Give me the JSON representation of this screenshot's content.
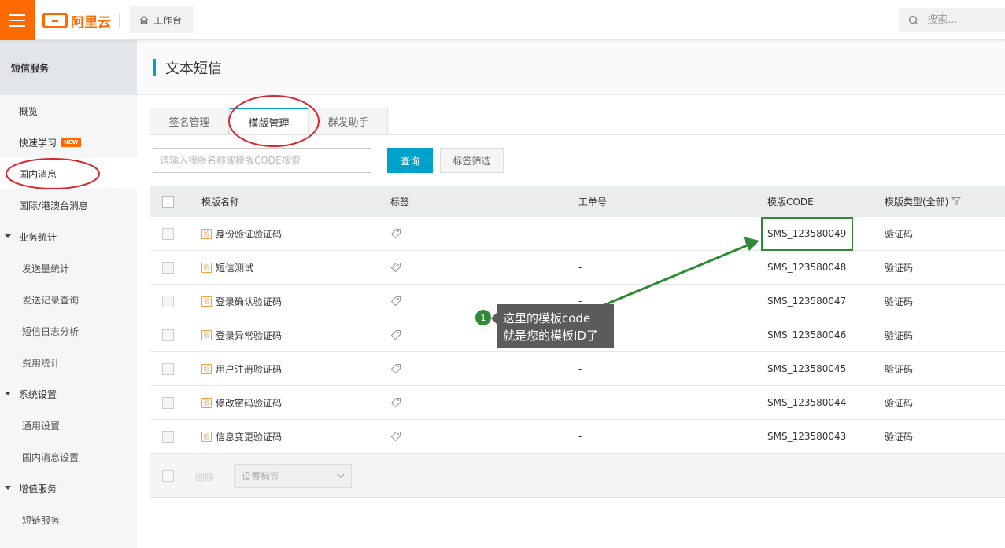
{
  "topbar": {
    "logo_text": "阿里云",
    "workbench_label": "工作台",
    "search_placeholder": "搜索..."
  },
  "sidebar": {
    "title": "短信服务",
    "items": [
      {
        "label": "概览"
      },
      {
        "label": "快速学习",
        "badge": "NEW"
      },
      {
        "label": "国内消息"
      },
      {
        "label": "国际/港澳台消息"
      },
      {
        "label": "业务统计"
      },
      {
        "label": "发送量统计"
      },
      {
        "label": "发送记录查询"
      },
      {
        "label": "短信日志分析"
      },
      {
        "label": "费用统计"
      },
      {
        "label": "系统设置"
      },
      {
        "label": "通用设置"
      },
      {
        "label": "国内消息设置"
      },
      {
        "label": "增值服务"
      },
      {
        "label": "短链服务"
      }
    ]
  },
  "page": {
    "title": "文本短信"
  },
  "tabs": [
    {
      "label": "签名管理"
    },
    {
      "label": "模版管理"
    },
    {
      "label": "群发助手"
    }
  ],
  "toolbar": {
    "search_placeholder": "请输入模版名称或模版CODE搜索",
    "query_label": "查询",
    "filter_label": "标签筛选"
  },
  "table": {
    "headers": {
      "name": "模版名称",
      "tag": "标签",
      "order": "工单号",
      "code": "模版CODE",
      "type": "模版类型(全部)"
    },
    "template_icon_text": "验",
    "rows": [
      {
        "name": "身份验证验证码",
        "order": "-",
        "code": "SMS_123580049",
        "type": "验证码"
      },
      {
        "name": "短信测试",
        "order": "-",
        "code": "SMS_123580048",
        "type": "验证码"
      },
      {
        "name": "登录确认验证码",
        "order": "-",
        "code": "SMS_123580047",
        "type": "验证码"
      },
      {
        "name": "登录异常验证码",
        "order": "-",
        "code": "SMS_123580046",
        "type": "验证码"
      },
      {
        "name": "用户注册验证码",
        "order": "-",
        "code": "SMS_123580045",
        "type": "验证码"
      },
      {
        "name": "修改密码验证码",
        "order": "-",
        "code": "SMS_123580044",
        "type": "验证码"
      },
      {
        "name": "信息变更验证码",
        "order": "-",
        "code": "SMS_123580043",
        "type": "验证码"
      }
    ],
    "footer": {
      "delete_label": "删除",
      "set_tag_label": "设置标签"
    }
  },
  "annotation": {
    "step": "1",
    "line1": "这里的模板code",
    "line2": "就是您的模板ID了"
  },
  "colors": {
    "brand": "#ff6a00",
    "accent": "#00a2ca",
    "annotation_red": "#d9262c",
    "annotation_green": "#2f8a36"
  }
}
